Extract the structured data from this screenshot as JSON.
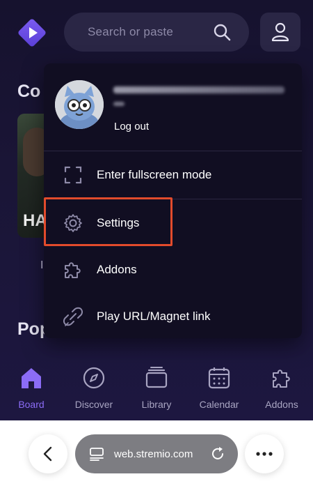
{
  "header": {
    "search_placeholder": "Search or paste"
  },
  "background": {
    "section1_title": "Co",
    "section2_title": "Pop",
    "poster_text": "HA",
    "poster_caption": "I"
  },
  "menu": {
    "logout_label": "Log out",
    "items": [
      {
        "label": "Enter fullscreen mode",
        "icon": "fullscreen-icon"
      },
      {
        "label": "Settings",
        "icon": "gear-icon"
      },
      {
        "label": "Addons",
        "icon": "puzzle-icon"
      },
      {
        "label": "Play URL/Magnet link",
        "icon": "magnet-link-icon"
      }
    ],
    "highlighted_item": "Settings"
  },
  "nav": {
    "items": [
      {
        "label": "Board",
        "icon": "home-icon",
        "active": true
      },
      {
        "label": "Discover",
        "icon": "compass-icon",
        "active": false
      },
      {
        "label": "Library",
        "icon": "library-icon",
        "active": false
      },
      {
        "label": "Calendar",
        "icon": "calendar-icon",
        "active": false
      },
      {
        "label": "Addons",
        "icon": "puzzle-icon",
        "active": false
      }
    ]
  },
  "browser": {
    "url": "web.stremio.com"
  },
  "colors": {
    "accent": "#8b6cf6",
    "highlight_box": "#e24b2c",
    "menu_bg": "#110e22",
    "app_bg": "#16122e"
  }
}
